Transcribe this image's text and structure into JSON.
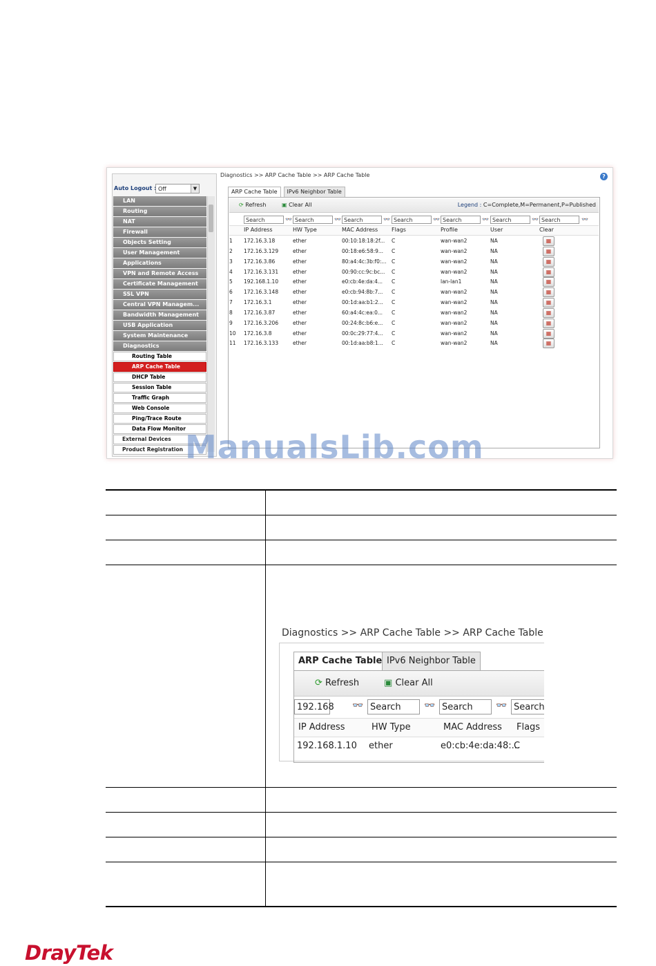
{
  "sidebar": {
    "auto_logout_label": "Auto Logout :",
    "auto_logout_value": "Off",
    "menu": [
      "LAN",
      "Routing",
      "NAT",
      "Firewall",
      "Objects Setting",
      "User Management",
      "Applications",
      "VPN and Remote Access",
      "Certificate Management",
      "SSL VPN",
      "Central VPN Managem...",
      "Bandwidth Management",
      "USB Application",
      "System Maintenance",
      "Diagnostics"
    ],
    "submenu": [
      "Routing Table",
      "ARP Cache Table",
      "DHCP Table",
      "Session Table",
      "Traffic Graph",
      "Web Console",
      "Ping/Trace Route",
      "Data Flow Monitor"
    ],
    "bottom": [
      "External Devices",
      "Product Registration"
    ]
  },
  "page": {
    "breadcrumb": "Diagnostics >> ARP Cache Table >> ARP Cache Table",
    "help_icon": "?",
    "tabs": [
      "ARP Cache Table",
      "IPv6 Neighbor Table"
    ],
    "refresh_label": "Refresh",
    "clear_all_label": "Clear All",
    "legend_label": "Legend :",
    "legend_text": "C=Complete,M=Permanent,P=Published",
    "search_placeholder": "Search",
    "columns": [
      "IP Address",
      "HW Type",
      "MAC Address",
      "Flags",
      "Profile",
      "User",
      "Clear"
    ],
    "rows": [
      [
        "1",
        "172.16.3.18",
        "ether",
        "00:10:18:18:2f...",
        "C",
        "wan-wan2",
        "NA"
      ],
      [
        "2",
        "172.16.3.129",
        "ether",
        "00:18:e6:58:9...",
        "C",
        "wan-wan2",
        "NA"
      ],
      [
        "3",
        "172.16.3.86",
        "ether",
        "80:a4:4c:3b:f0:...",
        "C",
        "wan-wan2",
        "NA"
      ],
      [
        "4",
        "172.16.3.131",
        "ether",
        "00:90:cc:9c:bc...",
        "C",
        "wan-wan2",
        "NA"
      ],
      [
        "5",
        "192.168.1.10",
        "ether",
        "e0:cb:4e:da:4...",
        "C",
        "lan-lan1",
        "NA"
      ],
      [
        "6",
        "172.16.3.148",
        "ether",
        "e0:cb:94:8b:7...",
        "C",
        "wan-wan2",
        "NA"
      ],
      [
        "7",
        "172.16.3.1",
        "ether",
        "00:1d:aa:b1:2...",
        "C",
        "wan-wan2",
        "NA"
      ],
      [
        "8",
        "172.16.3.87",
        "ether",
        "60:a4:4c:ea:0...",
        "C",
        "wan-wan2",
        "NA"
      ],
      [
        "9",
        "172.16.3.206",
        "ether",
        "00:24:8c:b6:e...",
        "C",
        "wan-wan2",
        "NA"
      ],
      [
        "10",
        "172.16.3.8",
        "ether",
        "00:0c:29:77:4...",
        "C",
        "wan-wan2",
        "NA"
      ],
      [
        "11",
        "172.16.3.133",
        "ether",
        "00:1d:aa:b8:1...",
        "C",
        "wan-wan2",
        "NA"
      ]
    ]
  },
  "watermark": "ManualsLib.com",
  "zoom": {
    "breadcrumb": "Diagnostics >> ARP Cache Table >> ARP Cache Table",
    "tabs": [
      "ARP Cache Table",
      "IPv6 Neighbor Table"
    ],
    "refresh_label": "Refresh",
    "clear_all_label": "Clear All",
    "search_value": "192.168",
    "search_placeholder": "Search",
    "columns": [
      "IP Address",
      "HW Type",
      "MAC Address",
      "Flags"
    ],
    "row": [
      "192.168.1.10",
      "ether",
      "e0:cb:4e:da:48:...",
      "C"
    ]
  },
  "logo": "DrayTek"
}
